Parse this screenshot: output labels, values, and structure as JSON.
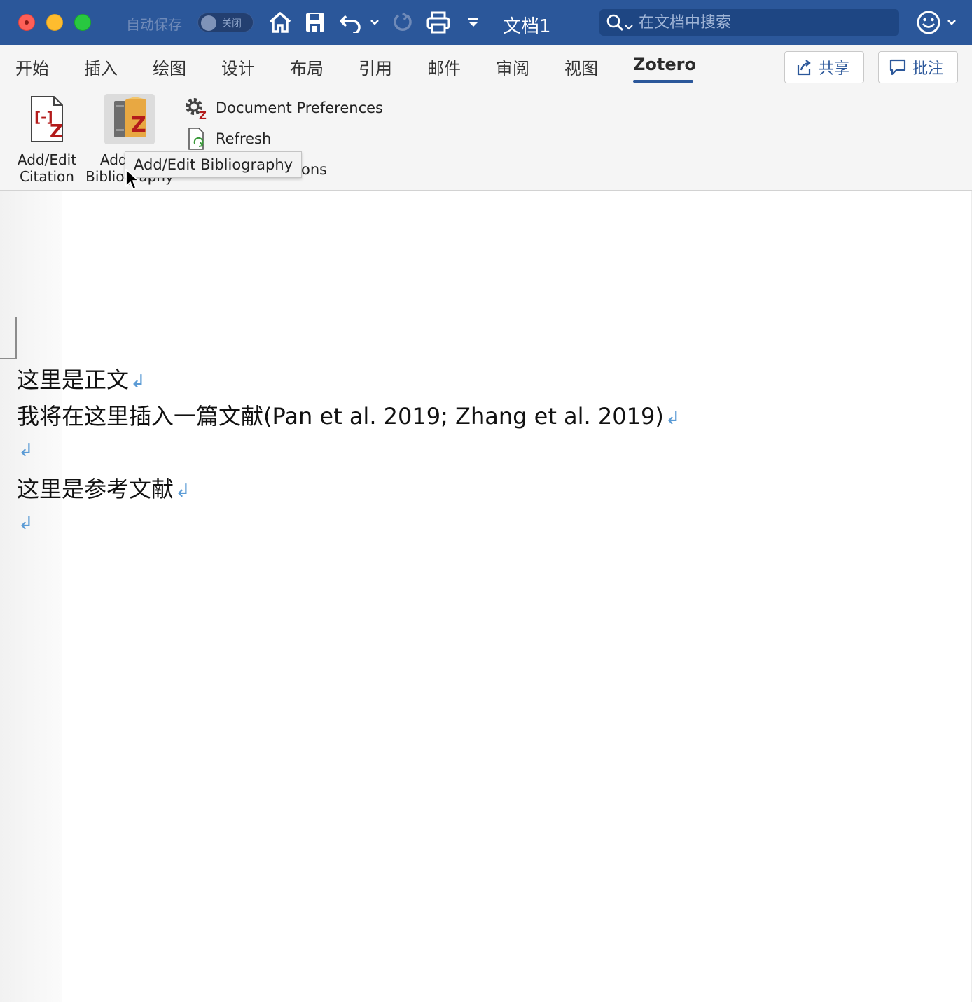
{
  "titlebar": {
    "autosave_label": "自动保存",
    "autosave_state": "关闭",
    "doc_title": "文档1",
    "search_placeholder": "在文档中搜索"
  },
  "tabs": [
    {
      "label": "开始"
    },
    {
      "label": "插入"
    },
    {
      "label": "绘图"
    },
    {
      "label": "设计"
    },
    {
      "label": "布局"
    },
    {
      "label": "引用"
    },
    {
      "label": "邮件"
    },
    {
      "label": "审阅"
    },
    {
      "label": "视图"
    },
    {
      "label": "Zotero",
      "active": true
    }
  ],
  "actions": {
    "share_label": "共享",
    "comments_label": "批注"
  },
  "zotero": {
    "citation_line1": "Add/Edit",
    "citation_line2": "Citation",
    "bibliography_line1": "Add/Edit",
    "bibliography_line2": "Bibliography",
    "doc_prefs": "Document Preferences",
    "refresh": "Refresh",
    "unlink_partial": "ons",
    "tooltip": "Add/Edit Bibliography"
  },
  "document": {
    "paragraphs": [
      "这里是正文",
      "我将在这里插入一篇文献(Pan et al. 2019; Zhang et al. 2019)",
      "",
      "这里是参考文献",
      ""
    ],
    "pilcrow": "↲"
  },
  "colors": {
    "titlebar": "#2b579a",
    "ribbon": "#f5f5f5",
    "accent": "#2b579a",
    "pilcrow": "#5b9bd5",
    "zotero_red": "#b31b1b"
  }
}
